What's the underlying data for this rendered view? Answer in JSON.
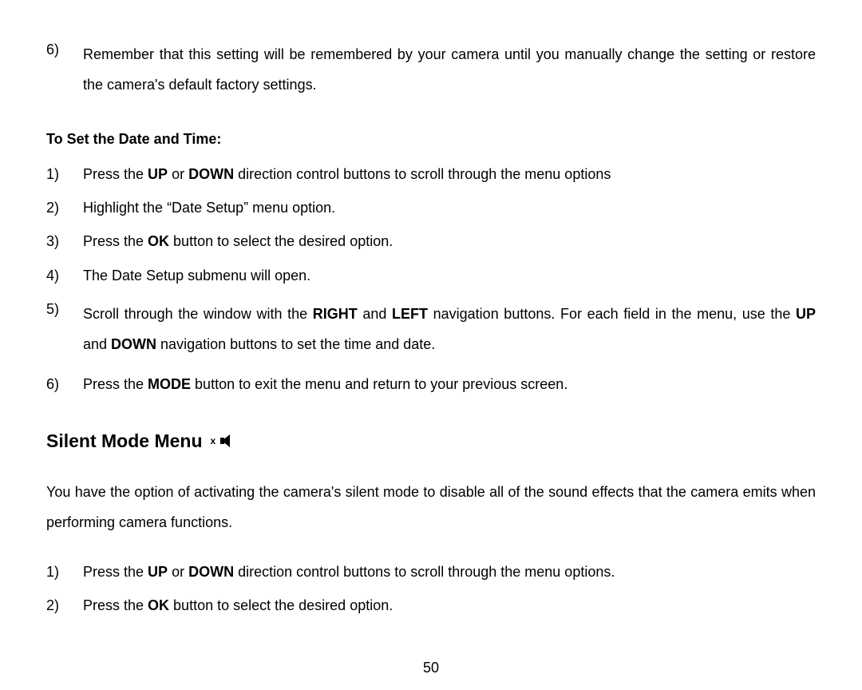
{
  "top_list": {
    "item6_num": "6)",
    "item6_text_a": "Remember that this setting will be remembered by your camera until you manually change the setting or restore the camera's default factory settings."
  },
  "subheading": "To Set the Date and Time:",
  "date_list": {
    "n1": "1)",
    "t1a": "Press the ",
    "t1b": "UP",
    "t1c": " or ",
    "t1d": "DOWN",
    "t1e": " direction control buttons to scroll through the menu options",
    "n2": "2)",
    "t2": "Highlight the “Date Setup” menu option.",
    "n3": "3)",
    "t3a": "Press the ",
    "t3b": "OK",
    "t3c": " button to select the desired option.",
    "n4": "4)",
    "t4": "The Date Setup submenu will open.",
    "n5": "5)",
    "t5a": "Scroll through the window with the ",
    "t5b": "RIGHT",
    "t5c": " and ",
    "t5d": "LEFT",
    "t5e": " navigation buttons. For each field in the menu, use the ",
    "t5f": "UP",
    "t5g": " and ",
    "t5h": "DOWN",
    "t5i": " navigation buttons to set the time and date.",
    "n6": "6)",
    "t6a": "Press the ",
    "t6b": "MODE",
    "t6c": " button to exit the menu and return to your previous screen."
  },
  "silent_heading": "Silent Mode Menu",
  "silent_para": "You have the option of activating the camera's silent mode to disable all of the sound effects that the camera emits when performing camera functions.",
  "silent_list": {
    "n1": "1)",
    "t1a": "Press the ",
    "t1b": "UP",
    "t1c": " or ",
    "t1d": "DOWN",
    "t1e": " direction control buttons to scroll through the menu options.",
    "n2": "2)",
    "t2a": "Press the ",
    "t2b": "OK",
    "t2c": " button to select the desired option."
  },
  "page_number": "50"
}
